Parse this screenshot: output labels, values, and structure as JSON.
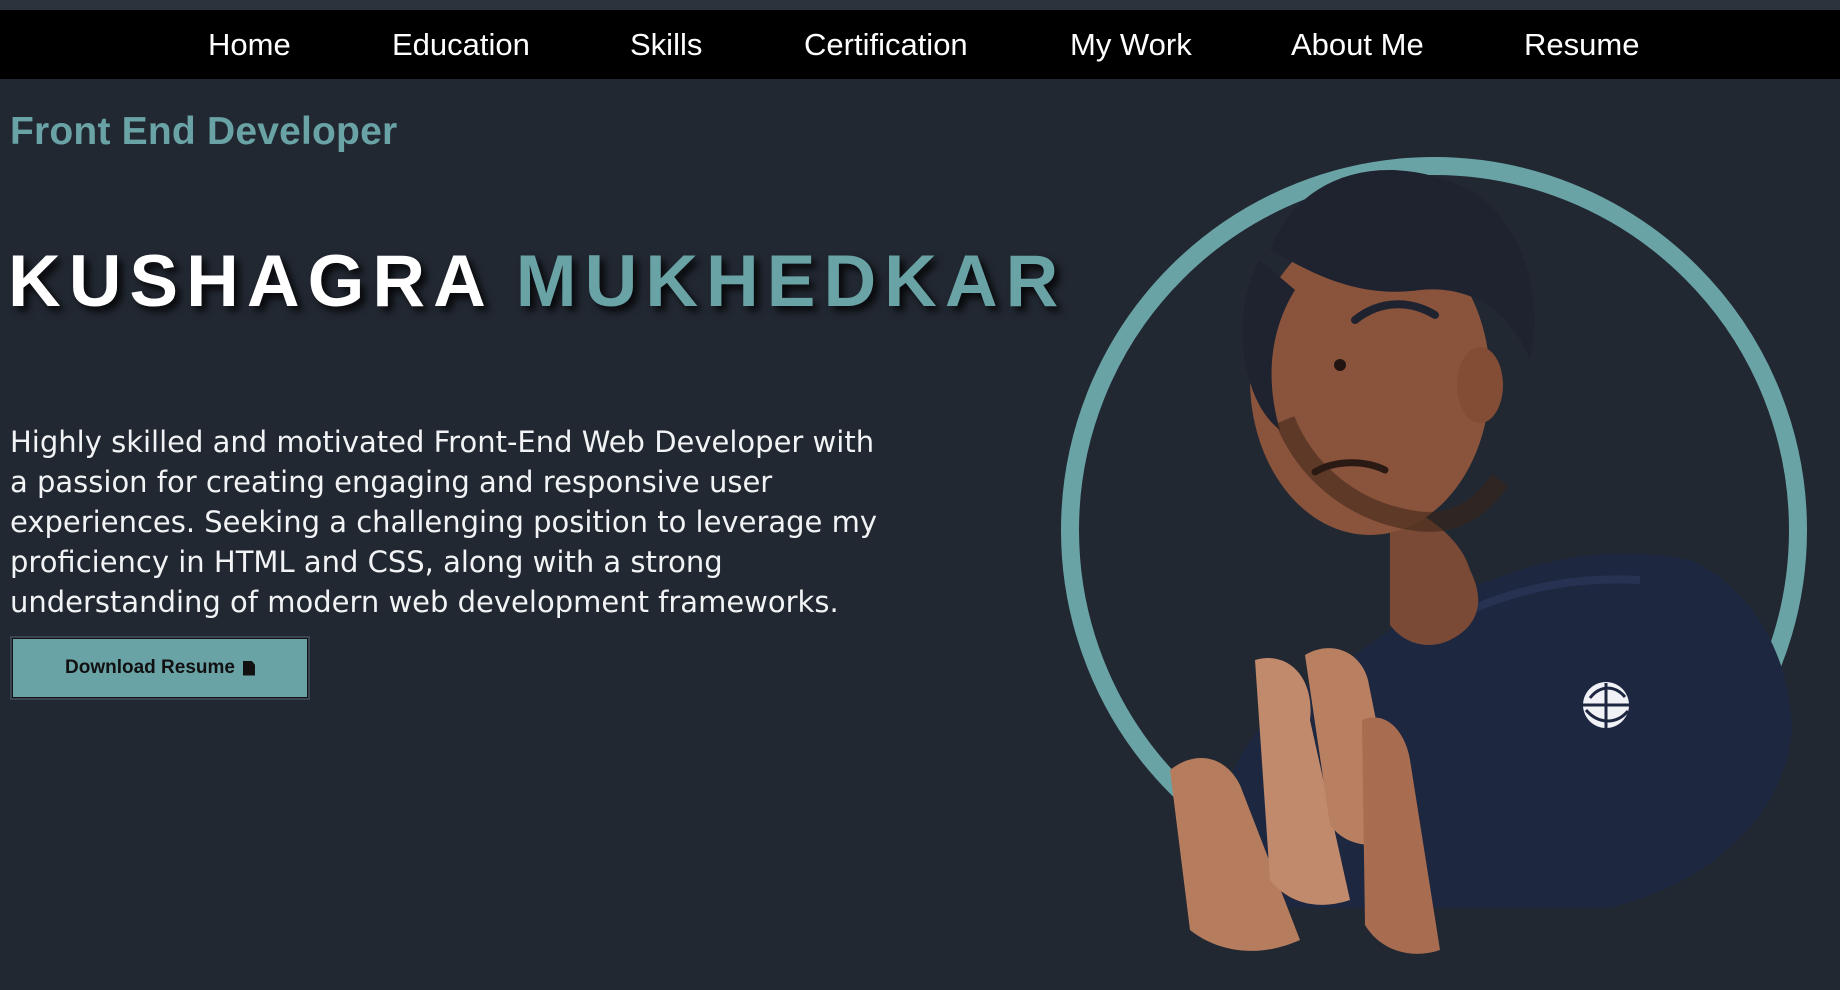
{
  "nav": {
    "items": [
      {
        "label": "Home"
      },
      {
        "label": "Education"
      },
      {
        "label": "Skills"
      },
      {
        "label": "Certification"
      },
      {
        "label": "My Work"
      },
      {
        "label": "About Me"
      },
      {
        "label": "Resume"
      }
    ]
  },
  "hero": {
    "role": "Front End Developer",
    "first_name": "KUSHAGRA",
    "last_name": "MUKHEDKAR",
    "bio": "Highly skilled and motivated Front-End Web Developer with a passion for creating engaging and responsive user experiences. Seeking a challenging position to leverage my proficiency in HTML and CSS, along with a strong understanding of modern web development frameworks.",
    "download_button": {
      "label": "Download Resume",
      "icon": "file-icon"
    }
  },
  "colors": {
    "background": "#222832",
    "navbar": "#000000",
    "accent": "#6aa3a6",
    "text": "#ffffff"
  }
}
